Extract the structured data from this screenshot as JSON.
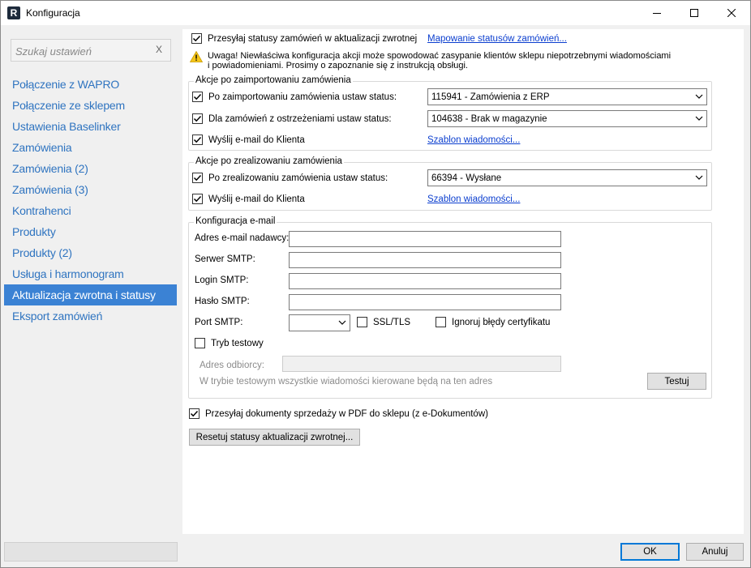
{
  "window": {
    "title": "Konfiguracja",
    "app_icon_letter": "R"
  },
  "sidebar": {
    "search_placeholder": "Szukaj ustawień",
    "search_clear": "X",
    "items": [
      {
        "label": "Połączenie z WAPRO"
      },
      {
        "label": "Połączenie ze sklepem"
      },
      {
        "label": "Ustawienia Baselinker"
      },
      {
        "label": "Zamówienia"
      },
      {
        "label": "Zamówienia (2)"
      },
      {
        "label": "Zamówienia (3)"
      },
      {
        "label": "Kontrahenci"
      },
      {
        "label": "Produkty"
      },
      {
        "label": "Produkty (2)"
      },
      {
        "label": "Usługa i harmonogram"
      },
      {
        "label": "Aktualizacja zwrotna i statusy"
      },
      {
        "label": "Eksport zamówień"
      }
    ],
    "active_index": 10
  },
  "main": {
    "send_statuses": {
      "label": "Przesyłaj statusy zamówień w aktualizacji zwrotnej",
      "checked": true,
      "link": "Mapowanie statusów zamówień..."
    },
    "warning": {
      "line1": "Uwaga! Niewłaściwa konfiguracja akcji może spowodować zasypanie klientów sklepu niepotrzebnymi wiadomościami",
      "line2": "i powiadomieniami. Prosimy o zapoznanie się z instrukcją obsługi."
    },
    "imported_group": {
      "title": "Akcje po zaimportowaniu zamówienia",
      "after_import": {
        "label": "Po zaimportowaniu zamówienia ustaw status:",
        "checked": true,
        "value": "115941 - Zamówienia z ERP"
      },
      "with_warnings": {
        "label": "Dla zamówień z ostrzeżeniami ustaw status:",
        "checked": true,
        "value": "104638 - Brak w magazynie"
      },
      "send_email": {
        "label": "Wyślij e-mail do Klienta",
        "checked": true,
        "link": "Szablon wiadomości..."
      }
    },
    "realized_group": {
      "title": "Akcje po zrealizowaniu zamówienia",
      "after_realize": {
        "label": "Po zrealizowaniu zamówienia ustaw status:",
        "checked": true,
        "value": "66394 - Wysłane"
      },
      "send_email": {
        "label": "Wyślij e-mail do Klienta",
        "checked": true,
        "link": "Szablon wiadomości..."
      }
    },
    "email_group": {
      "title": "Konfiguracja e-mail",
      "sender_label": "Adres e-mail nadawcy:",
      "sender_value": "",
      "smtp_server_label": "Serwer SMTP:",
      "smtp_server_value": "",
      "smtp_login_label": "Login SMTP:",
      "smtp_login_value": "",
      "smtp_password_label": "Hasło SMTP:",
      "smtp_password_value": "",
      "port_label": "Port SMTP:",
      "port_value": "",
      "ssl_label": "SSL/TLS",
      "ssl_checked": false,
      "ignore_cert_label": "Ignoruj błędy certyfikatu",
      "ignore_cert_checked": false,
      "test_mode_label": "Tryb testowy",
      "test_mode_checked": false,
      "recipient_label": "Adres odbiorcy:",
      "recipient_value": "",
      "test_note": "W trybie testowym wszystkie wiadomości kierowane będą na ten adres",
      "test_button": "Testuj"
    },
    "send_pdf": {
      "label": "Przesyłaj dokumenty sprzedaży w PDF do sklepu (z e-Dokumentów)",
      "checked": true
    },
    "reset_button": "Resetuj statusy aktualizacji zwrotnej..."
  },
  "footer": {
    "ok": "OK",
    "cancel": "Anuluj"
  },
  "colors": {
    "accent": "#3b82d4",
    "link": "#0b3ecf",
    "nav_text": "#2f74c0"
  }
}
